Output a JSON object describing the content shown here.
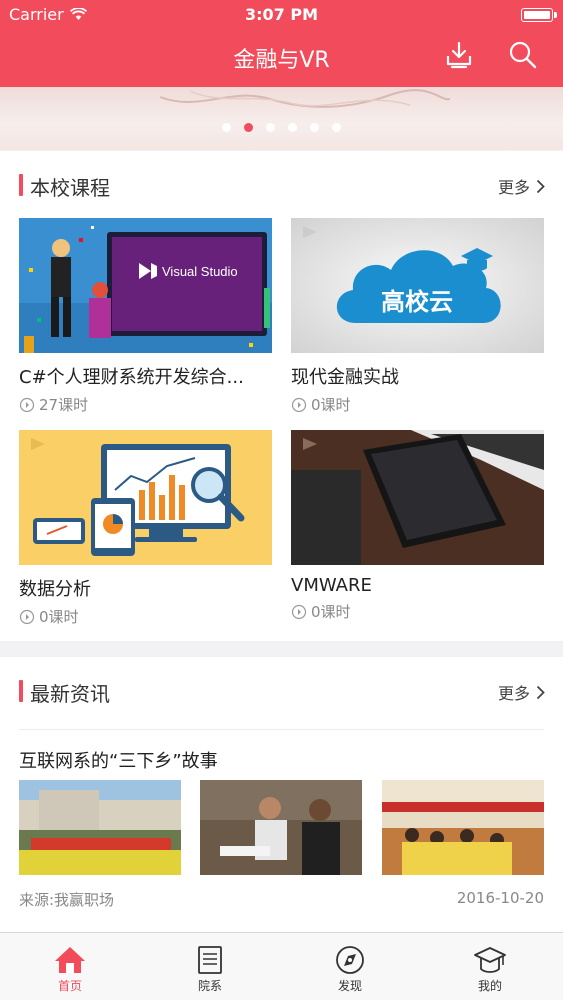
{
  "status_bar": {
    "carrier": "Carrier",
    "time": "3:07 PM"
  },
  "header": {
    "title": "金融与VR",
    "download_icon": "download-icon",
    "search_icon": "search-icon"
  },
  "banner": {
    "dots_total": 6,
    "active_index": 1
  },
  "courses": {
    "title": "本校课程",
    "more": "更多",
    "items": [
      {
        "title": "C#个人理财系统开发综合...",
        "lessons": "27课时",
        "image": "visual-studio"
      },
      {
        "title": "现代金融实战",
        "lessons": "0课时",
        "image": "高校云"
      },
      {
        "title": "数据分析",
        "lessons": "0课时",
        "image": "analytics"
      },
      {
        "title": "VMWARE",
        "lessons": "0课时",
        "image": "tablet"
      }
    ]
  },
  "news": {
    "title": "最新资讯",
    "more": "更多",
    "items": [
      {
        "title": "互联网系的“三下乡”故事",
        "source": "来源:我赢职场",
        "date": "2016-10-20"
      }
    ]
  },
  "tabs": [
    {
      "label": "首页",
      "icon": "home-icon",
      "active": true
    },
    {
      "label": "院系",
      "icon": "document-icon",
      "active": false
    },
    {
      "label": "发现",
      "icon": "compass-icon",
      "active": false
    },
    {
      "label": "我的",
      "icon": "graduation-cap-icon",
      "active": false
    }
  ],
  "colors": {
    "accent": "#f24b5b",
    "text": "#222222",
    "muted": "#888888",
    "background": "#f2f2f4"
  }
}
